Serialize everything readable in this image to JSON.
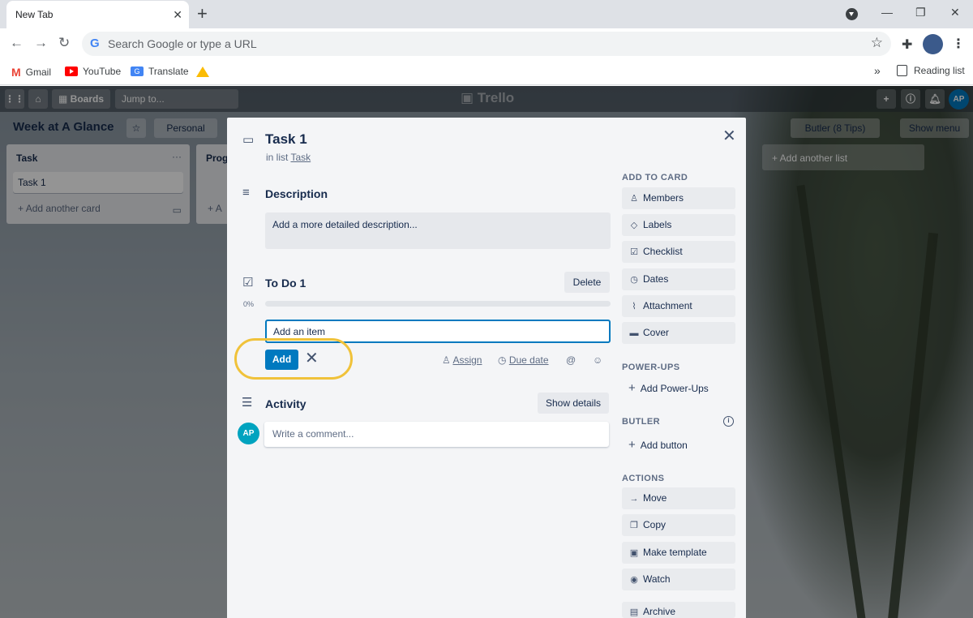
{
  "browser": {
    "tab_title": "New Tab",
    "omnibox_placeholder": "Search Google or type a URL",
    "bookmarks": [
      "Gmail",
      "YouTube",
      "Translate"
    ],
    "reading_list": "Reading list",
    "more": "»"
  },
  "trello": {
    "boards_label": "Boards",
    "jump_placeholder": "Jump to...",
    "logo": "Trello",
    "user_initials": "AP",
    "board_title": "Week at A Glance",
    "visibility": "Personal",
    "butler": "Butler (8 Tips)",
    "show_menu": "Show menu",
    "add_another_list": "+ Add another list",
    "lists": [
      {
        "title": "Task",
        "cards": [
          "Task 1"
        ],
        "add_card": "Add another card"
      },
      {
        "title": "Prog",
        "add_card": "A"
      }
    ]
  },
  "modal": {
    "title": "Task 1",
    "in_list_prefix": "in list",
    "in_list_name": "Task",
    "description_title": "Description",
    "description_placeholder": "Add a more detailed description...",
    "checklist_title": "To Do 1",
    "delete_label": "Delete",
    "progress_label": "0%",
    "progress_value": 0,
    "item_input_value": "Add an item",
    "add_label": "Add",
    "assign_label": "Assign",
    "due_date_label": "Due date",
    "activity_title": "Activity",
    "show_details_label": "Show details",
    "user_initials": "AP",
    "comment_placeholder": "Write a comment...",
    "sidebar": {
      "add_to_card_heading": "ADD TO CARD",
      "add_to_card": [
        "Members",
        "Labels",
        "Checklist",
        "Dates",
        "Attachment",
        "Cover"
      ],
      "powerups_heading": "POWER-UPS",
      "add_powerups": "Add Power-Ups",
      "butler_heading": "BUTLER",
      "add_button": "Add button",
      "actions_heading": "ACTIONS",
      "actions": [
        "Move",
        "Copy",
        "Make template",
        "Watch",
        "Archive"
      ]
    }
  },
  "colors": {
    "accent": "#0079bf",
    "highlight": "#f0c23a"
  }
}
